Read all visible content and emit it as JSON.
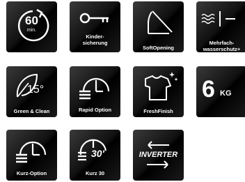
{
  "tiles": {
    "timer": {
      "value": "60",
      "unit": "min."
    },
    "kindersicherung": {
      "label_line1": "Kinder-",
      "label_line2": "sicherung"
    },
    "softopening": {
      "label": "SoftOpening"
    },
    "mehrfach": {
      "label_line1": "Mehrfach-",
      "label_line2": "wasserschutz+"
    },
    "green": {
      "value": "15°",
      "label": "Green & Clean"
    },
    "rapid": {
      "label": "Rapid Option"
    },
    "freshfinish": {
      "label": "FreshFinish"
    },
    "capacity": {
      "value": "6",
      "unit": "KG"
    },
    "kurz": {
      "label": "Kurz-Option"
    },
    "kurz30": {
      "value": "30'",
      "label": "Kurz 30"
    },
    "inverter": {
      "label": "INVERTER"
    }
  },
  "colors": {
    "tile_bg": "#111111",
    "foreground": "#ffffff",
    "page_bg": "#ffffff"
  }
}
